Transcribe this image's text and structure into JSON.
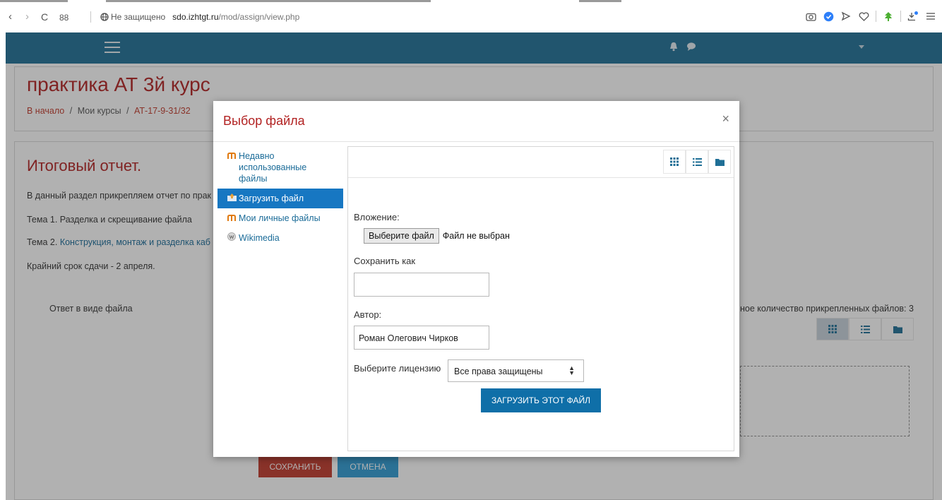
{
  "browser": {
    "back": "‹",
    "forward": "›",
    "reload": "C",
    "apps": "88",
    "insecure_label": "Не защищено",
    "url_domain": "sdo.izhtgt.ru",
    "url_path": "/mod/assign/view.php"
  },
  "course": {
    "title": "практика АТ 3й курс",
    "breadcrumb": {
      "home": "В начало",
      "sep": "/",
      "my_courses": "Мои курсы",
      "course_code": "АТ-17-9-31/32"
    }
  },
  "assignment": {
    "title": "Итоговый отчет.",
    "description_line": "В данный раздел прикрепляем отчет по прак",
    "topic1": "Тема 1. Разделка и скрещивание файла",
    "topic2_prefix": "Тема 2.",
    "topic2_link": "Конструкция, монтаж и разделка каб",
    "deadline": "Крайний срок сдачи - 2 апреля.",
    "answer_label": "Ответ в виде файла",
    "max_files": "ное количество прикрепленных файлов: 3",
    "save_label": "СОХРАНИТЬ",
    "cancel_label": "ОТМЕНА"
  },
  "dialog": {
    "title": "Выбор файла",
    "close": "×",
    "repositories": [
      {
        "label": "Недавно использованные файлы",
        "icon": "moodle-icon"
      },
      {
        "label": "Загрузить файл",
        "icon": "upload-icon"
      },
      {
        "label": "Мои личные файлы",
        "icon": "moodle-icon"
      },
      {
        "label": "Wikimedia",
        "icon": "wikimedia-icon"
      }
    ],
    "active_repository": "Загрузить файл",
    "attachment_label": "Вложение:",
    "choose_file_button": "Выберите файл",
    "no_file_chosen": "Файл не выбран",
    "save_as_label": "Сохранить как",
    "save_as_value": "",
    "author_label": "Автор:",
    "author_value": "Роман Олегович Чирков",
    "license_label": "Выберите лицензию",
    "license_value": "Все права защищены",
    "upload_button": "ЗАГРУЗИТЬ ЭТОТ ФАЙЛ"
  },
  "colors": {
    "navbar": "#1f6f96",
    "brand_red": "#b22222",
    "active_repo": "#1777c2",
    "upload_button": "#0f6fa8",
    "save_button": "#c0392b",
    "cancel_button": "#2e9bd4"
  }
}
